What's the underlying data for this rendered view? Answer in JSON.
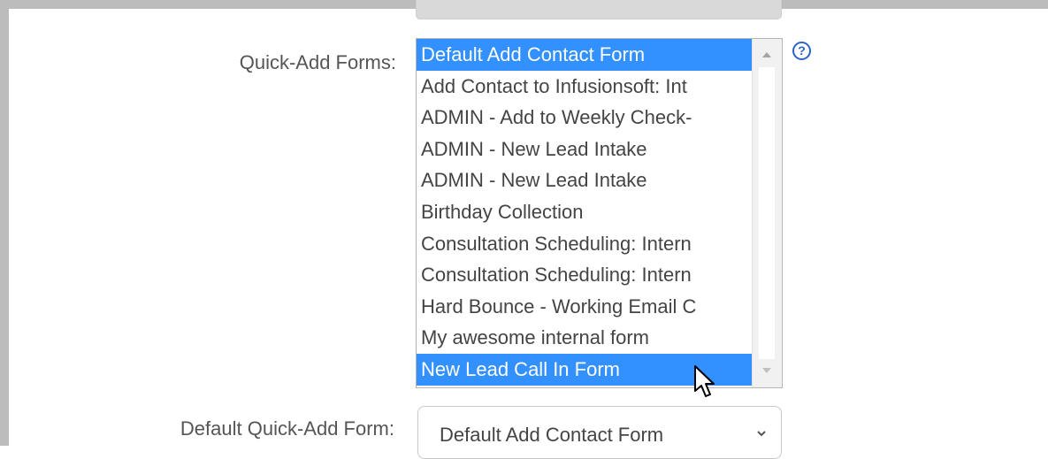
{
  "form": {
    "quick_add_label": "Quick-Add Forms:",
    "default_label": "Default Quick-Add Form:",
    "help_symbol": "?",
    "quick_add_options": [
      "Default Add Contact Form",
      "Add Contact to Infusionsoft: Int",
      "ADMIN - Add to Weekly Check-",
      "ADMIN - New Lead Intake",
      "ADMIN - New Lead Intake",
      "Birthday Collection",
      "Consultation Scheduling: Intern",
      "Consultation Scheduling: Intern",
      "Hard Bounce - Working Email C",
      "My awesome internal form",
      "New Lead Call In Form"
    ],
    "selected_indices": [
      0,
      10
    ],
    "default_value": "Default Add Contact Form"
  },
  "colors": {
    "selection": "#3390ff",
    "help": "#2b63c9",
    "label": "#555555"
  },
  "icons": {
    "help": "help-circle-icon",
    "chevron": "chevron-down-icon",
    "cursor": "mouse-pointer-icon"
  }
}
